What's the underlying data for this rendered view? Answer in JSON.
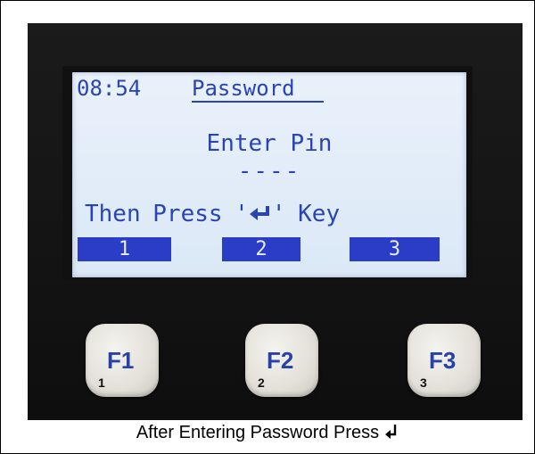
{
  "lcd": {
    "time": "08:54",
    "title": "Password",
    "prompt": "Enter Pin",
    "pin_mask": "----",
    "instruction_before": "Then Press '",
    "enter_icon": "enter-key-icon",
    "instruction_after": "' Key",
    "softkeys": [
      "1",
      "2",
      "3"
    ]
  },
  "keys": [
    {
      "label": "F1",
      "number": "1"
    },
    {
      "label": "F2",
      "number": "2"
    },
    {
      "label": "F3",
      "number": "3"
    }
  ],
  "caption": {
    "text": "After Entering Password Press",
    "icon": "return-arrow-icon"
  },
  "colors": {
    "lcd_text": "#2a44b4",
    "lcd_background": "#e3edf8",
    "softkey_background": "#2b3cc6",
    "key_label": "#2642a8",
    "device_body": "#161616"
  }
}
